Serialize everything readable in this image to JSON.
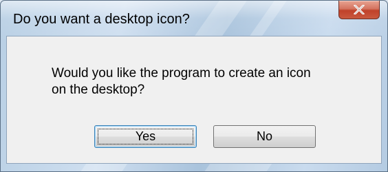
{
  "dialog": {
    "title": "Do you want a desktop icon?",
    "message_lines": [
      "Would you like the program to create an icon",
      "on the desktop?"
    ],
    "buttons": {
      "yes_label": "Yes",
      "no_label": "No"
    },
    "close_icon": "close-x-icon",
    "colors": {
      "close_button": "#c9593f",
      "client_background": "#f0f0f0",
      "default_button_border": "#3c7fb1"
    }
  }
}
